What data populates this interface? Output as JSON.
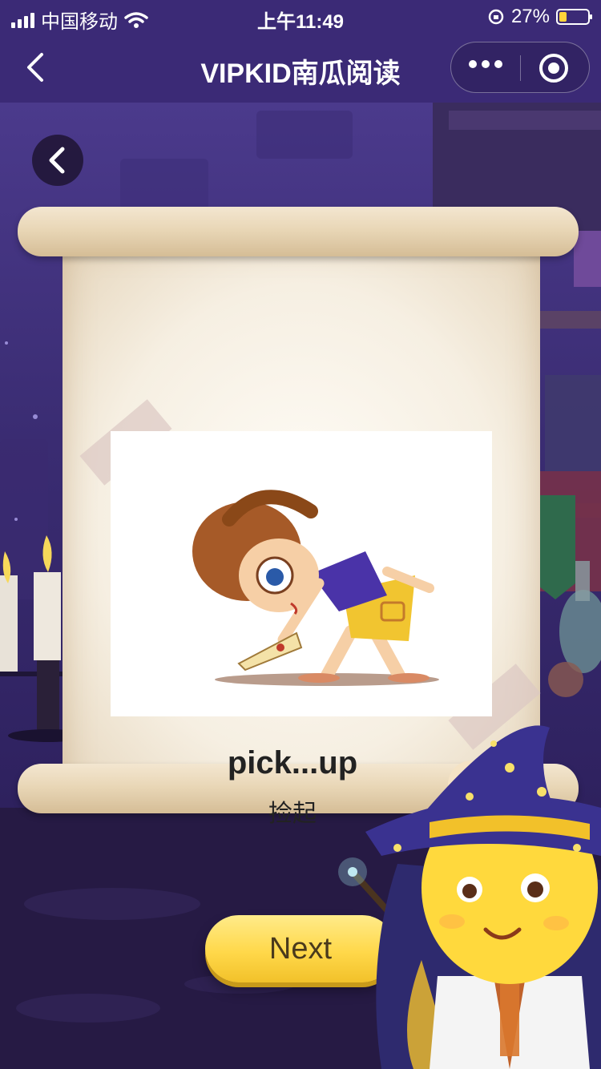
{
  "status_bar": {
    "carrier": "中国移动",
    "time": "上午11:49",
    "battery_percent": "27%",
    "battery_level": 0.27
  },
  "nav": {
    "title": "VIPKID南瓜阅读"
  },
  "card": {
    "word": "pick...up",
    "meaning": "捡起"
  },
  "next_button": {
    "label": "Next"
  },
  "colors": {
    "nav_bg": "#3b2a76",
    "next_button": "#ffd84a",
    "scroll_paper": "#f6efe2"
  },
  "icons": [
    "back-icon",
    "more-icon",
    "target-icon",
    "wifi-icon",
    "signal-icon",
    "battery-icon",
    "orientation-lock-icon",
    "speaker-icon"
  ]
}
